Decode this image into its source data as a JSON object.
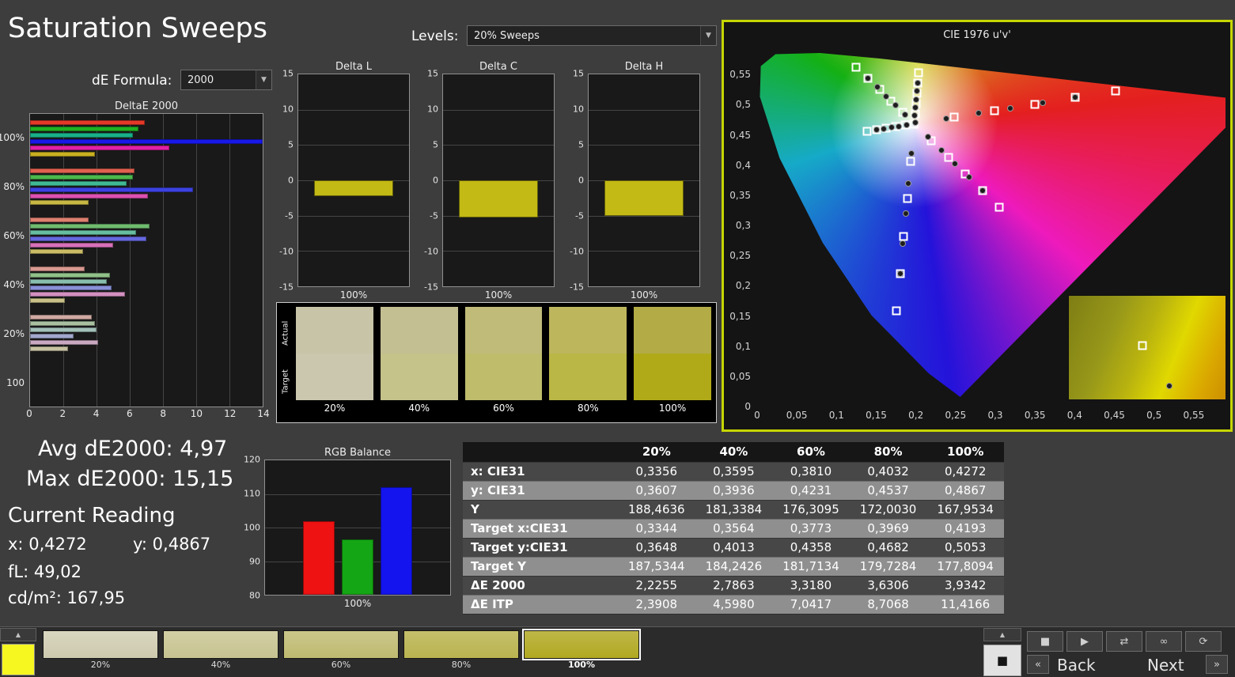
{
  "page": {
    "title": "Saturation Sweeps"
  },
  "controls": {
    "de_formula_label": "dE Formula:",
    "de_formula_value": "2000",
    "levels_label": "Levels:",
    "levels_value": "20% Sweeps"
  },
  "readings": {
    "avg_label": "Avg dE2000:",
    "avg_value": "4,97",
    "max_label": "Max dE2000:",
    "max_value": "15,15",
    "section_title": "Current Reading",
    "x_label": "x:",
    "x_value": "0,4272",
    "y_label": "y:",
    "y_value": "0,4867",
    "fl_label": "fL:",
    "fl_value": "49,02",
    "cd_label": "cd/m²:",
    "cd_value": "167,95"
  },
  "chart_data": [
    {
      "id": "deltae2000",
      "type": "bar",
      "orientation": "horizontal",
      "title": "DeltaE 2000",
      "xlim": [
        0,
        14
      ],
      "xticks": [
        0,
        2,
        4,
        6,
        8,
        10,
        12,
        14
      ],
      "groups": [
        {
          "label": "100%",
          "bars": [
            {
              "c": "#e43828",
              "v": 6.9
            },
            {
              "c": "#20b020",
              "v": 6.5
            },
            {
              "c": "#18b088",
              "v": 6.2
            },
            {
              "c": "#1818e8",
              "v": 14.9
            },
            {
              "c": "#e020a8",
              "v": 8.4
            },
            {
              "c": "#c8b020",
              "v": 3.9
            }
          ]
        },
        {
          "label": "80%",
          "bars": [
            {
              "c": "#e0604e",
              "v": 6.3
            },
            {
              "c": "#4cb84c",
              "v": 6.2
            },
            {
              "c": "#40b894",
              "v": 5.8
            },
            {
              "c": "#3c42e0",
              "v": 9.8
            },
            {
              "c": "#dc50b0",
              "v": 7.1
            },
            {
              "c": "#c8b844",
              "v": 3.5
            }
          ]
        },
        {
          "label": "60%",
          "bars": [
            {
              "c": "#dd8070",
              "v": 3.5
            },
            {
              "c": "#70bb70",
              "v": 7.2
            },
            {
              "c": "#66bda0",
              "v": 6.4
            },
            {
              "c": "#6668dd",
              "v": 7.0
            },
            {
              "c": "#d870b8",
              "v": 5.0
            },
            {
              "c": "#cabb66",
              "v": 3.2
            }
          ]
        },
        {
          "label": "40%",
          "bars": [
            {
              "c": "#d89890",
              "v": 3.3
            },
            {
              "c": "#90c088",
              "v": 4.8
            },
            {
              "c": "#88bead",
              "v": 4.6
            },
            {
              "c": "#8890d8",
              "v": 4.9
            },
            {
              "c": "#d290c0",
              "v": 5.7
            },
            {
              "c": "#c8c088",
              "v": 2.1
            }
          ]
        },
        {
          "label": "20%",
          "bars": [
            {
              "c": "#cfa9a2",
              "v": 3.7
            },
            {
              "c": "#a8c0a0",
              "v": 3.9
            },
            {
              "c": "#a2c0b8",
              "v": 4.0
            },
            {
              "c": "#a2a8cc",
              "v": 2.6
            },
            {
              "c": "#c9a8c2",
              "v": 4.1
            },
            {
              "c": "#c6c2a2",
              "v": 2.3
            }
          ]
        },
        {
          "label": "100",
          "bars": []
        }
      ]
    },
    {
      "id": "delta_l",
      "type": "bar",
      "title": "Delta L",
      "xlabel": "100%",
      "ylim": [
        -15,
        15
      ],
      "yticks": [
        15,
        10,
        5,
        0,
        -5,
        -10,
        -15
      ],
      "value": -2.2,
      "bar_color": "#c3ba15"
    },
    {
      "id": "delta_c",
      "type": "bar",
      "title": "Delta C",
      "xlabel": "100%",
      "ylim": [
        -15,
        15
      ],
      "yticks": [
        15,
        10,
        5,
        0,
        -5,
        -10,
        -15
      ],
      "value": -5.3,
      "bar_color": "#c3ba15"
    },
    {
      "id": "delta_h",
      "type": "bar",
      "title": "Delta H",
      "xlabel": "100%",
      "ylim": [
        -15,
        15
      ],
      "yticks": [
        15,
        10,
        5,
        0,
        -5,
        -10,
        -15
      ],
      "value": -5.0,
      "bar_color": "#c3ba15"
    },
    {
      "id": "rgb_balance",
      "type": "bar",
      "title": "RGB Balance",
      "xlabel": "100%",
      "ylim": [
        80,
        120
      ],
      "yticks": [
        120,
        110,
        100,
        90,
        80
      ],
      "bars": [
        {
          "c": "#ee1212",
          "v": 102
        },
        {
          "c": "#14a614",
          "v": 96.5
        },
        {
          "c": "#1414ee",
          "v": 112
        }
      ]
    },
    {
      "id": "cie",
      "type": "scatter",
      "title": "CIE 1976 u'v'",
      "x_max": 0.59,
      "y_max": 0.6,
      "tick_step": 0.05,
      "xtick_labels": [
        "0",
        "0,05",
        "0,1",
        "0,15",
        "0,2",
        "0,25",
        "0,3",
        "0,35",
        "0,4",
        "0,45",
        "0,5",
        "0,55"
      ],
      "ytick_labels": [
        "0",
        "0,05",
        "0,1",
        "0,15",
        "0,2",
        "0,25",
        "0,3",
        "0,35",
        "0,4",
        "0,45",
        "0,5",
        "0,55"
      ],
      "locus": [
        [
          0.2557,
          0.0159
        ],
        [
          0.2161,
          0.0549
        ],
        [
          0.1441,
          0.151
        ],
        [
          0.0828,
          0.2708
        ],
        [
          0.0282,
          0.4117
        ],
        [
          0.0035,
          0.5131
        ],
        [
          0.0046,
          0.5639
        ],
        [
          0.0231,
          0.5836
        ],
        [
          0.0792,
          0.5856
        ],
        [
          0.1531,
          0.5766
        ],
        [
          0.2623,
          0.5604
        ],
        [
          0.4034,
          0.5393
        ],
        [
          0.5203,
          0.5219
        ],
        [
          0.6234,
          0.5065
        ]
      ],
      "targets": [
        [
          0.1978,
          0.4683
        ],
        [
          0.2486,
          0.479
        ],
        [
          0.2992,
          0.49
        ],
        [
          0.3498,
          0.501
        ],
        [
          0.4004,
          0.512
        ],
        [
          0.451,
          0.523
        ],
        [
          0.1834,
          0.4872
        ],
        [
          0.1688,
          0.5061
        ],
        [
          0.1542,
          0.525
        ],
        [
          0.1396,
          0.5439
        ],
        [
          0.125,
          0.5625
        ],
        [
          0.1935,
          0.4062
        ],
        [
          0.189,
          0.3441
        ],
        [
          0.1845,
          0.282
        ],
        [
          0.18,
          0.2199
        ],
        [
          0.1754,
          0.1579
        ],
        [
          0.1861,
          0.4658
        ],
        [
          0.1742,
          0.4633
        ],
        [
          0.1623,
          0.4608
        ],
        [
          0.1504,
          0.4582
        ],
        [
          0.1385,
          0.4557
        ],
        [
          0.2195,
          0.4405
        ],
        [
          0.241,
          0.4128
        ],
        [
          0.2625,
          0.385
        ],
        [
          0.284,
          0.3573
        ],
        [
          0.3053,
          0.3295
        ],
        [
          0.199,
          0.4852
        ],
        [
          0.2002,
          0.5021
        ],
        [
          0.2014,
          0.519
        ],
        [
          0.2026,
          0.5359
        ],
        [
          0.2038,
          0.5528
        ]
      ],
      "measurements": [
        [
          0.1992,
          0.4702
        ],
        [
          0.2384,
          0.4767
        ],
        [
          0.2789,
          0.4854
        ],
        [
          0.3194,
          0.4942
        ],
        [
          0.36,
          0.503
        ],
        [
          0.4006,
          0.5117
        ],
        [
          0.1862,
          0.4834
        ],
        [
          0.1746,
          0.4985
        ],
        [
          0.1629,
          0.5136
        ],
        [
          0.1513,
          0.5287
        ],
        [
          0.1397,
          0.5438
        ],
        [
          0.1942,
          0.4186
        ],
        [
          0.1906,
          0.3689
        ],
        [
          0.187,
          0.3193
        ],
        [
          0.1834,
          0.2696
        ],
        [
          0.1799,
          0.22
        ],
        [
          0.1883,
          0.4663
        ],
        [
          0.1788,
          0.4643
        ],
        [
          0.1693,
          0.4623
        ],
        [
          0.1598,
          0.4603
        ],
        [
          0.1503,
          0.4583
        ],
        [
          0.2152,
          0.4461
        ],
        [
          0.2324,
          0.4239
        ],
        [
          0.2496,
          0.4017
        ],
        [
          0.2668,
          0.3795
        ],
        [
          0.284,
          0.3573
        ],
        [
          0.1988,
          0.4818
        ],
        [
          0.1998,
          0.4953
        ],
        [
          0.2007,
          0.5088
        ],
        [
          0.2017,
          0.5223
        ],
        [
          0.2026,
          0.5358
        ]
      ],
      "inset": {
        "square": [
          0.47,
          0.48
        ],
        "circle": [
          0.64,
          0.87
        ]
      }
    }
  ],
  "swatch_strip": {
    "row_labels": [
      "Actual",
      "Target"
    ],
    "columns": [
      {
        "label": "20%",
        "actual": "#c7c4a8",
        "target": "#cac7ae"
      },
      {
        "label": "40%",
        "actual": "#c4bf92",
        "target": "#c5c28a"
      },
      {
        "label": "60%",
        "actual": "#c1bb7a",
        "target": "#bfbc6b"
      },
      {
        "label": "80%",
        "actual": "#bdb65d",
        "target": "#bab746"
      },
      {
        "label": "100%",
        "actual": "#b3ab46",
        "target": "#b0aa19"
      }
    ]
  },
  "table": {
    "headers": [
      "",
      "20%",
      "40%",
      "60%",
      "80%",
      "100%"
    ],
    "rows": [
      {
        "label": "x: CIE31",
        "values": [
          "0,3356",
          "0,3595",
          "0,3810",
          "0,4032",
          "0,4272"
        ]
      },
      {
        "label": "y: CIE31",
        "values": [
          "0,3607",
          "0,3936",
          "0,4231",
          "0,4537",
          "0,4867"
        ]
      },
      {
        "label": "Y",
        "values": [
          "188,4636",
          "181,3384",
          "176,3095",
          "172,0030",
          "167,9534"
        ]
      },
      {
        "label": "Target x:CIE31",
        "values": [
          "0,3344",
          "0,3564",
          "0,3773",
          "0,3969",
          "0,4193"
        ]
      },
      {
        "label": "Target y:CIE31",
        "values": [
          "0,3648",
          "0,4013",
          "0,4358",
          "0,4682",
          "0,5053"
        ]
      },
      {
        "label": "Target Y",
        "values": [
          "187,5344",
          "184,2426",
          "181,7134",
          "179,7284",
          "177,8094"
        ]
      },
      {
        "label": "ΔE 2000",
        "values": [
          "2,2255",
          "2,7863",
          "3,3180",
          "3,6306",
          "3,9342"
        ]
      },
      {
        "label": "ΔE ITP",
        "values": [
          "2,3908",
          "4,5980",
          "7,0417",
          "8,7068",
          "11,4166"
        ]
      }
    ]
  },
  "bottom_bar": {
    "corner_swatch_color": "#f6f620",
    "swatches": [
      {
        "label": "20%",
        "top": "#dad7c0",
        "bottom": "#ccc9ae"
      },
      {
        "label": "40%",
        "top": "#d2cfa5",
        "bottom": "#c6c290"
      },
      {
        "label": "60%",
        "top": "#cbc78a",
        "bottom": "#bfba70"
      },
      {
        "label": "80%",
        "top": "#c5c06b",
        "bottom": "#b9b350"
      },
      {
        "label": "100%",
        "top": "#beb748",
        "bottom": "#b1a920",
        "active": true
      }
    ],
    "transport": [
      {
        "name": "stop",
        "glyph": "■"
      },
      {
        "name": "play",
        "glyph": "▶"
      },
      {
        "name": "shuttle",
        "glyph": "⇄"
      },
      {
        "name": "loop",
        "glyph": "∞"
      },
      {
        "name": "refresh",
        "glyph": "⟳"
      }
    ],
    "prev_glyph": "«",
    "back_label": "Back",
    "next_label": "Next",
    "next_glyph": "»"
  }
}
